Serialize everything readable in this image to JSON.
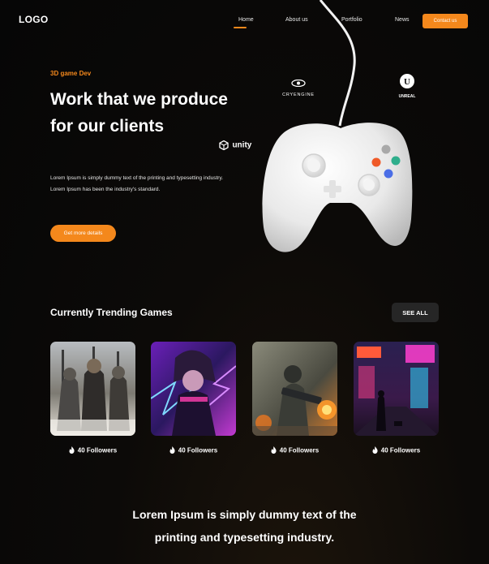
{
  "header": {
    "logo": "LOGO",
    "nav": [
      {
        "label": "Home",
        "active": true
      },
      {
        "label": "About us"
      },
      {
        "label": "Portfolio"
      },
      {
        "label": "News"
      }
    ],
    "contact_label": "Contact us"
  },
  "hero": {
    "eyebrow": "3D game Dev",
    "title": "Work that we produce for our clients",
    "description": "Lorem Ipsum is simply dummy text of the printing and typesetting industry. Lorem Ipsum has been the industry's standard.",
    "cta_label": "Get more details",
    "engines": {
      "cryengine": "CRYENGINE",
      "unreal": "UNREAL",
      "unity": "unity"
    }
  },
  "trending": {
    "title": "Currently Trending Games",
    "see_all_label": "SEE ALL",
    "games": [
      {
        "followers": "40 Followers",
        "art": "warriors"
      },
      {
        "followers": "40 Followers",
        "art": "neon-character"
      },
      {
        "followers": "40 Followers",
        "art": "soldier"
      },
      {
        "followers": "40 Followers",
        "art": "cyberpunk-street"
      }
    ]
  },
  "bottom": {
    "line1": "Lorem Ipsum is simply dummy text of the",
    "line2": "printing and typesetting industry."
  },
  "colors": {
    "accent": "#f4881c",
    "background": "#0b0a09",
    "button_dark": "#262626"
  }
}
